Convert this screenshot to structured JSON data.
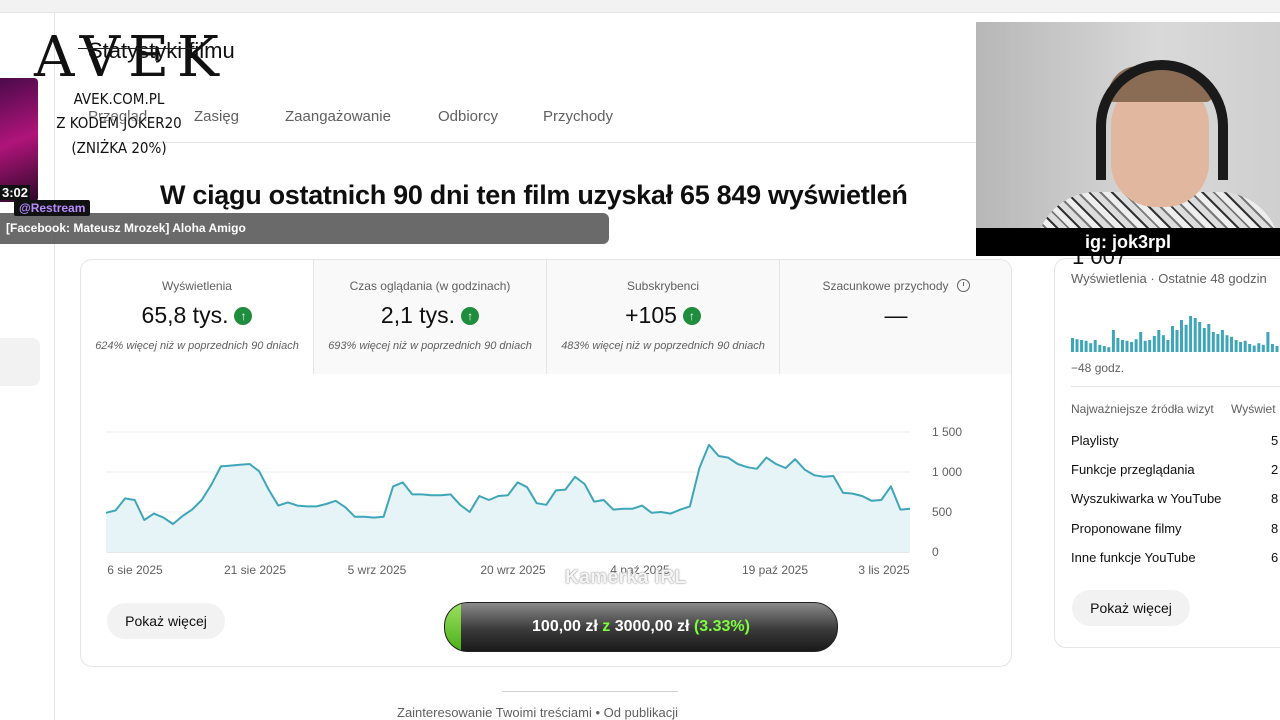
{
  "page": {
    "title": "Statystyki filmu",
    "tabs": [
      "Przegląd",
      "Zasięg",
      "Zaangażowanie",
      "Odbiorcy",
      "Przychody"
    ],
    "headline": "W ciągu ostatnich 90 dni ten film uzyskał 65 849 wyświetleń"
  },
  "metrics": [
    {
      "label": "Wyświetlenia",
      "value": "65,8 tys.",
      "trend": "up",
      "sub": "624% więcej niż w poprzednich 90 dniach"
    },
    {
      "label": "Czas oglądania (w godzinach)",
      "value": "2,1 tys.",
      "trend": "up",
      "sub": "693% więcej niż w poprzednich 90 dniach"
    },
    {
      "label": "Subskrybenci",
      "value": "+105",
      "trend": "up",
      "sub": "483% więcej niż w poprzednich 90 dniach"
    },
    {
      "label": "Szacunkowe przychody",
      "value": "—",
      "icon": "clock-icon"
    }
  ],
  "chart_data": {
    "type": "area",
    "x_tick_labels": [
      "6 sie 2025",
      "21 sie 2025",
      "5 wrz 2025",
      "20 wrz 2025",
      "4 paź 2025",
      "19 paź 2025",
      "3 lis 2025"
    ],
    "y_tick_labels": [
      "1 500",
      "1 000",
      "500",
      "0"
    ],
    "ylim": [
      0,
      1500
    ],
    "grid": true,
    "color": "#3ea6b8",
    "values": [
      490,
      520,
      670,
      650,
      400,
      480,
      430,
      350,
      450,
      530,
      650,
      840,
      1070,
      1080,
      1090,
      1100,
      1010,
      780,
      580,
      620,
      580,
      570,
      570,
      600,
      640,
      560,
      440,
      440,
      430,
      440,
      820,
      870,
      720,
      720,
      710,
      710,
      720,
      590,
      500,
      700,
      650,
      700,
      710,
      870,
      810,
      610,
      590,
      770,
      780,
      940,
      850,
      630,
      650,
      530,
      540,
      540,
      580,
      490,
      500,
      480,
      530,
      570,
      1050,
      1340,
      1200,
      1180,
      1100,
      1060,
      1040,
      1180,
      1100,
      1050,
      1160,
      1030,
      960,
      940,
      950,
      740,
      730,
      700,
      640,
      650,
      820,
      530,
      540
    ]
  },
  "buttons": {
    "show_more": "Pokaż więcej"
  },
  "donation": {
    "current": "100,00 zł",
    "sep": "z",
    "goal": "3000,00 zł",
    "percent": "(3.33%)",
    "progress": 0.0333
  },
  "camera_label": "Kamerka IRL",
  "footer": "Zainteresowanie Twoimi treściami • Od publikacji",
  "right_panel": {
    "top_number": "1 007",
    "label": "Wyświetlenia · Ostatnie 48 godzin",
    "since": "−48 godz.",
    "sources_header": "Najważniejsze źródła wizyt",
    "sources_col": "Wyświet",
    "sources": [
      {
        "name": "Playlisty",
        "value": "5"
      },
      {
        "name": "Funkcje przeglądania",
        "value": "2"
      },
      {
        "name": "Wyszukiwarka w YouTube",
        "value": "8"
      },
      {
        "name": "Proponowane filmy",
        "value": "8"
      },
      {
        "name": "Inne funkcje YouTube",
        "value": "6"
      }
    ],
    "spark_values": [
      0.35,
      0.32,
      0.3,
      0.28,
      0.22,
      0.3,
      0.18,
      0.15,
      0.12,
      0.55,
      0.35,
      0.3,
      0.28,
      0.25,
      0.32,
      0.5,
      0.28,
      0.3,
      0.4,
      0.55,
      0.42,
      0.3,
      0.65,
      0.55,
      0.8,
      0.68,
      0.9,
      0.85,
      0.75,
      0.6,
      0.7,
      0.5,
      0.45,
      0.55,
      0.42,
      0.38,
      0.3,
      0.25,
      0.28,
      0.2,
      0.16,
      0.22,
      0.18,
      0.5,
      0.2,
      0.15
    ]
  },
  "webcam": {
    "caption": "ig: jok3rpl"
  },
  "overlay": {
    "logo": "AVEK",
    "promo_lines": [
      "AVEK.COM.PL",
      "Z KODEM JOKER20",
      "(ZNIŻKA 20%)"
    ],
    "stream_time": "3:02",
    "restream": "@Restream",
    "chat_message": "[Facebook: Mateusz Mrozek] Aloha Amigo"
  }
}
